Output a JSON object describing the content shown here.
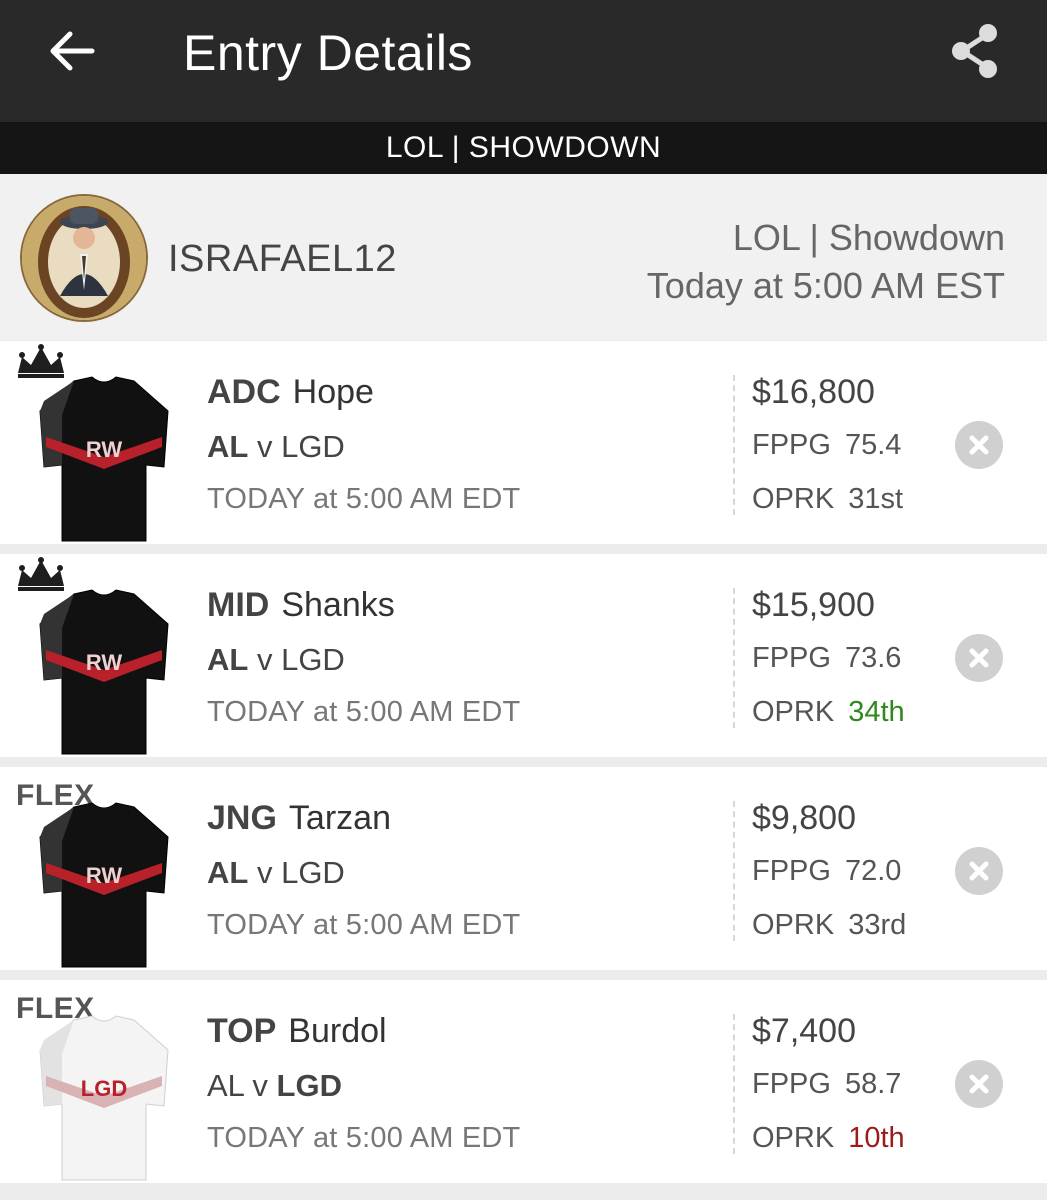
{
  "appbar": {
    "title": "Entry Details",
    "back_icon": "arrow-left-icon",
    "share_icon": "share-icon"
  },
  "contest_banner": "LOL | SHOWDOWN",
  "entry": {
    "username": "ISRAFAEL12",
    "contest_name": "LOL | Showdown",
    "contest_time": "Today at 5:00 AM EST"
  },
  "colors": {
    "appbar": "#292929",
    "banner": "#151515",
    "rank_good": "#2e8a1e",
    "rank_bad": "#9b1c1c",
    "jersey_rw": "#b8202a"
  },
  "lineup": [
    {
      "slot": "captain",
      "slot_icon": "crown-icon",
      "slot_label": "",
      "position": "ADC",
      "player": "Hope",
      "matchup_home": "AL",
      "matchup_sep": "v",
      "matchup_away": "LGD",
      "team": "AL",
      "game_time": "TODAY at 5:00 AM EDT",
      "salary": "$16,800",
      "fppg_label": "FPPG",
      "fppg": "75.4",
      "oprk_label": "OPRK",
      "oprk": "31st",
      "oprk_tone": "neutral",
      "jersey": "RW"
    },
    {
      "slot": "captain",
      "slot_icon": "crown-icon",
      "slot_label": "",
      "position": "MID",
      "player": "Shanks",
      "matchup_home": "AL",
      "matchup_sep": "v",
      "matchup_away": "LGD",
      "team": "AL",
      "game_time": "TODAY at 5:00 AM EDT",
      "salary": "$15,900",
      "fppg_label": "FPPG",
      "fppg": "73.6",
      "oprk_label": "OPRK",
      "oprk": "34th",
      "oprk_tone": "good",
      "jersey": "RW"
    },
    {
      "slot": "flex",
      "slot_icon": "",
      "slot_label": "FLEX",
      "position": "JNG",
      "player": "Tarzan",
      "matchup_home": "AL",
      "matchup_sep": "v",
      "matchup_away": "LGD",
      "team": "AL",
      "game_time": "TODAY at 5:00 AM EDT",
      "salary": "$9,800",
      "fppg_label": "FPPG",
      "fppg": "72.0",
      "oprk_label": "OPRK",
      "oprk": "33rd",
      "oprk_tone": "neutral",
      "jersey": "RW"
    },
    {
      "slot": "flex",
      "slot_icon": "",
      "slot_label": "FLEX",
      "position": "TOP",
      "player": "Burdol",
      "matchup_home": "AL",
      "matchup_sep": "v",
      "matchup_away": "LGD",
      "team": "LGD",
      "game_time": "TODAY at 5:00 AM EDT",
      "salary": "$7,400",
      "fppg_label": "FPPG",
      "fppg": "58.7",
      "oprk_label": "OPRK",
      "oprk": "10th",
      "oprk_tone": "bad",
      "jersey": "LGD"
    }
  ]
}
